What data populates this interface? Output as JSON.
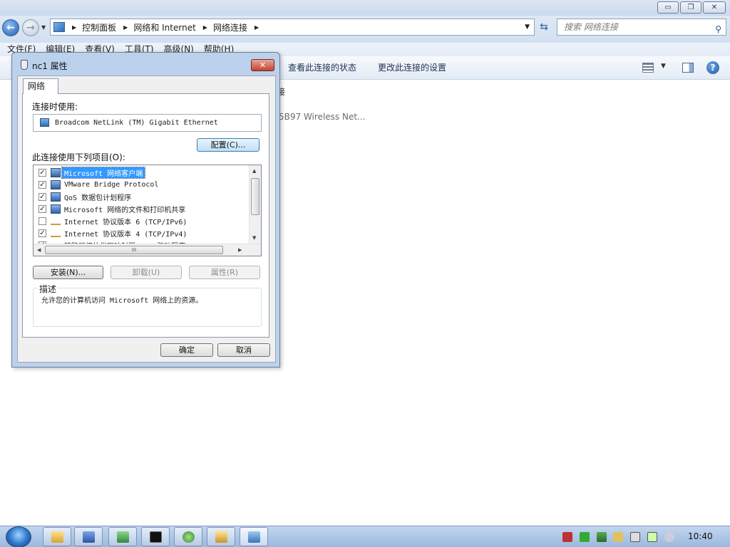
{
  "window": {
    "caption_buttons": {
      "minimize": "▭",
      "maximize": "❐",
      "close": "✕"
    }
  },
  "address": {
    "crumbs": [
      "控制面板",
      "网络和 Internet",
      "网络连接"
    ],
    "search_placeholder": "搜索 网络连接"
  },
  "menu": [
    "文件(F)",
    "编辑(E)",
    "查看(V)",
    "工具(T)",
    "高级(N)",
    "帮助(H)"
  ],
  "commandbar": {
    "view_status": "查看此连接的状态",
    "change_settings": "更改此连接的设置",
    "help": "?"
  },
  "background_content": {
    "fragment1": "接",
    "fragment2": "5B97 Wireless Net..."
  },
  "dialog": {
    "title": "nc1 属性",
    "close": "✕",
    "tab": "网络",
    "connect_using_label": "连接时使用:",
    "adapter_name": "Broadcom NetLink (TM) Gigabit Ethernet",
    "configure_button": "配置(C)...",
    "items_label": "此连接使用下列项目(O):",
    "items": [
      {
        "label": "Microsoft 网络客户端",
        "checked": true,
        "selected": true,
        "icon": "network-client-icon"
      },
      {
        "label": "VMware Bridge Protocol",
        "checked": true,
        "selected": false,
        "icon": "network-service-icon"
      },
      {
        "label": "QoS 数据包计划程序",
        "checked": true,
        "selected": false,
        "icon": "network-service-icon"
      },
      {
        "label": "Microsoft 网络的文件和打印机共享",
        "checked": true,
        "selected": false,
        "icon": "network-service-icon"
      },
      {
        "label": "Internet 协议版本 6 (TCP/IPv6)",
        "checked": false,
        "selected": false,
        "icon": "protocol-icon"
      },
      {
        "label": "Internet 协议版本 4 (TCP/IPv4)",
        "checked": true,
        "selected": false,
        "icon": "protocol-icon"
      },
      {
        "label": "链路层拓扑发现映射器 I/O 驱动程序",
        "checked": true,
        "selected": false,
        "icon": "protocol-icon"
      }
    ],
    "hscroll_grip": "III",
    "install_button": "安装(N)...",
    "uninstall_button": "卸载(U)",
    "properties_button": "属性(R)",
    "description_label": "描述",
    "description_text": "允许您的计算机访问 Microsoft 网络上的资源。",
    "ok_button": "确定",
    "cancel_button": "取消"
  },
  "taskbar": {
    "pinned": [
      "explorer-icon",
      "word-icon",
      "excel-icon",
      "cmd-icon",
      "ie-icon",
      "notes-icon",
      "network-icon"
    ],
    "clock": "10:40"
  }
}
